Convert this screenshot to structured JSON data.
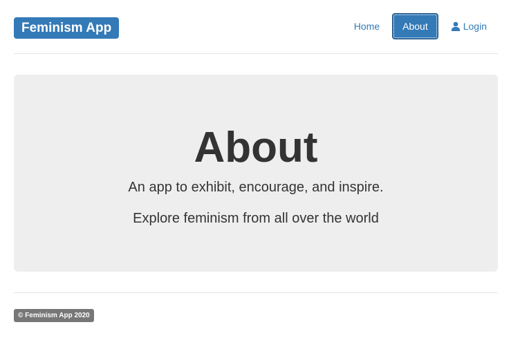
{
  "navbar": {
    "brand": "Feminism App",
    "links": [
      {
        "label": "Home",
        "active": false
      },
      {
        "label": "About",
        "active": true
      },
      {
        "label": "Login",
        "active": false,
        "icon": "user-icon"
      }
    ]
  },
  "jumbotron": {
    "title": "About",
    "lead1": "An app to exhibit, encourage, and inspire.",
    "lead2": "Explore feminism from all over the world"
  },
  "footer": {
    "copyright": "© Feminism App 2020"
  },
  "colors": {
    "primary": "#337ab7",
    "jumbotron_bg": "#eeeeee",
    "badge_bg": "#777777"
  }
}
